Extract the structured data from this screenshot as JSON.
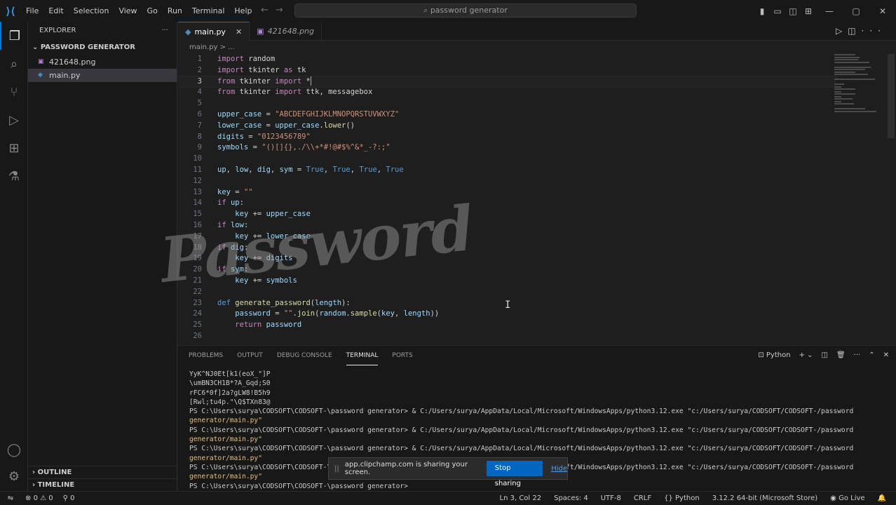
{
  "titlebar": {
    "menu": [
      "File",
      "Edit",
      "Selection",
      "View",
      "Go",
      "Run",
      "Terminal",
      "Help"
    ],
    "search": "password generator"
  },
  "explorer": {
    "title": "EXPLORER",
    "folder": "PASSWORD GENERATOR",
    "files": [
      {
        "name": "421648.png",
        "icon": "image-file-icon"
      },
      {
        "name": "main.py",
        "icon": "python-file-icon"
      }
    ],
    "outline": "OUTLINE",
    "timeline": "TIMELINE"
  },
  "tabs": [
    {
      "label": "main.py",
      "active": true
    },
    {
      "label": "421648.png",
      "active": false
    }
  ],
  "breadcrumb": "main.py > ...",
  "code": [
    "import random",
    "import tkinter as tk",
    "from tkinter import *",
    "from tkinter import ttk, messagebox",
    "",
    "upper_case = \"ABCDEFGHIJKLMNOPQRSTUVWXYZ\"",
    "lower_case = upper_case.lower()",
    "digits = \"0123456789\"",
    "symbols = \"()[]{},./\\\\+*#!@#$%^&*_-?:;\"",
    "",
    "up, low, dig, sym = True, True, True, True",
    "",
    "key = \"\"",
    "if up:",
    "    key += upper_case",
    "if low:",
    "    key += lower_case",
    "if dig:",
    "    key += digits",
    "if sym:",
    "    key += symbols",
    "",
    "def generate_password(length):",
    "    password = \"\".join(random.sample(key, length))",
    "    return password",
    ""
  ],
  "watermark": "Password",
  "panel": {
    "tabs": [
      "PROBLEMS",
      "OUTPUT",
      "DEBUG CONSOLE",
      "TERMINAL",
      "PORTS"
    ],
    "active_tab": "TERMINAL",
    "shell": "Python",
    "terminal_lines": [
      "YyK^NJ0Et[k1(eoX_\"]P",
      "\\umBN3CH1B*?A_Gqd;S0",
      "rFC6*0f]2a?gLW8!B5h9",
      "[Rwl;tu4p.\"\\Q$TXn83@",
      "PS C:\\Users\\surya\\CODSOFT\\CODSOFT-\\password generator> & C:/Users/surya/AppData/Local/Microsoft/WindowsApps/python3.12.exe \"c:/Users/surya/CODSOFT/CODSOFT-/password",
      "generator/main.py\"",
      "PS C:\\Users\\surya\\CODSOFT\\CODSOFT-\\password generator> & C:/Users/surya/AppData/Local/Microsoft/WindowsApps/python3.12.exe \"c:/Users/surya/CODSOFT/CODSOFT-/password",
      "generator/main.py\"",
      "PS C:\\Users\\surya\\CODSOFT\\CODSOFT-\\password generator> & C:/Users/surya/AppData/Local/Microsoft/WindowsApps/python3.12.exe \"c:/Users/surya/CODSOFT/CODSOFT-/password",
      "generator/main.py\"",
      "PS C:\\Users\\surya\\CODSOFT\\CODSOFT-\\password generator> & C:/Users/surya/AppData/Local/Microsoft/WindowsApps/python3.12.exe \"c:/Users/surya/CODSOFT/CODSOFT-/password",
      "generator/main.py\"",
      "PS C:\\Users\\surya\\CODSOFT\\CODSOFT-\\password generator>"
    ]
  },
  "sharing": {
    "message": "app.clipchamp.com is sharing your screen.",
    "stop": "Stop sharing",
    "hide": "Hide"
  },
  "statusbar": {
    "errors": "0",
    "warnings": "0",
    "ports": "0",
    "position": "Ln 3, Col 22",
    "spaces": "Spaces: 4",
    "encoding": "UTF-8",
    "eol": "CRLF",
    "language": "Python",
    "interpreter": "3.12.2 64-bit (Microsoft Store)",
    "golive": "Go Live"
  },
  "colors": {
    "accent": "#0078d4",
    "background": "#1e1e1e",
    "sidebar": "#181818"
  }
}
